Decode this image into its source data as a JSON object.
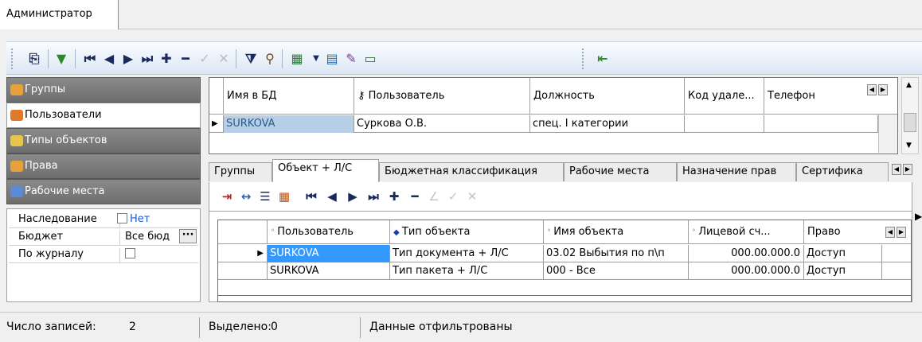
{
  "window": {
    "tab_label": "Администратор"
  },
  "toolbar": {
    "icons": [
      "copy-icon",
      "filter-down-icon",
      "first-record-icon",
      "prev-record-icon",
      "next-record-icon",
      "last-record-icon",
      "add-icon",
      "delete-icon",
      "confirm-icon",
      "cancel-icon",
      "filter-icon",
      "find-icon",
      "export-icon",
      "report-icon",
      "edit-icon",
      "form-icon",
      "exit-icon"
    ]
  },
  "nav": {
    "items": [
      {
        "label": "Группы",
        "active": false,
        "color": "#e8a03a"
      },
      {
        "label": "Пользователи",
        "active": true,
        "color": "#e07a2a"
      },
      {
        "label": "Типы объектов",
        "active": false,
        "color": "#e8c44a"
      },
      {
        "label": "Права",
        "active": false,
        "color": "#e8a03a"
      },
      {
        "label": "Рабочие места",
        "active": false,
        "color": "#5a8ad8"
      }
    ]
  },
  "props": {
    "inherit_label": "Наследование",
    "inherit_value": "Нет",
    "budget_label": "Бюджет",
    "budget_value": "Все бюд",
    "journal_label": "По журналу"
  },
  "users_grid": {
    "columns": [
      "Имя в БД",
      "Пользователь",
      "Должность",
      "Код удале...",
      "Телефон"
    ],
    "rows": [
      [
        "SURKOVA",
        "Суркова О.В.",
        "спец. I категории",
        "",
        ""
      ]
    ]
  },
  "detail_tabs": [
    "Группы",
    "Объект + Л/С",
    "Бюджетная классификация",
    "Рабочие места",
    "Назначение прав",
    "Сертифика"
  ],
  "detail_grid": {
    "columns": [
      "Пользователь",
      "Тип объекта",
      "Имя объекта",
      "Лицевой сч...",
      "Право"
    ],
    "rows": [
      [
        "SURKOVA",
        "Тип документа + Л/С",
        "03.02 Выбытия по п\\п",
        "000.00.000.0",
        "Доступ"
      ],
      [
        "SURKOVA",
        "Тип пакета + Л/С",
        "000 - Все",
        "000.00.000.0",
        "Доступ"
      ]
    ]
  },
  "status": {
    "records_label": "Число записей:",
    "records_value": "2",
    "selected_label": "Выделено:",
    "selected_value": "0",
    "filter_text": "Данные отфильтрованы"
  }
}
